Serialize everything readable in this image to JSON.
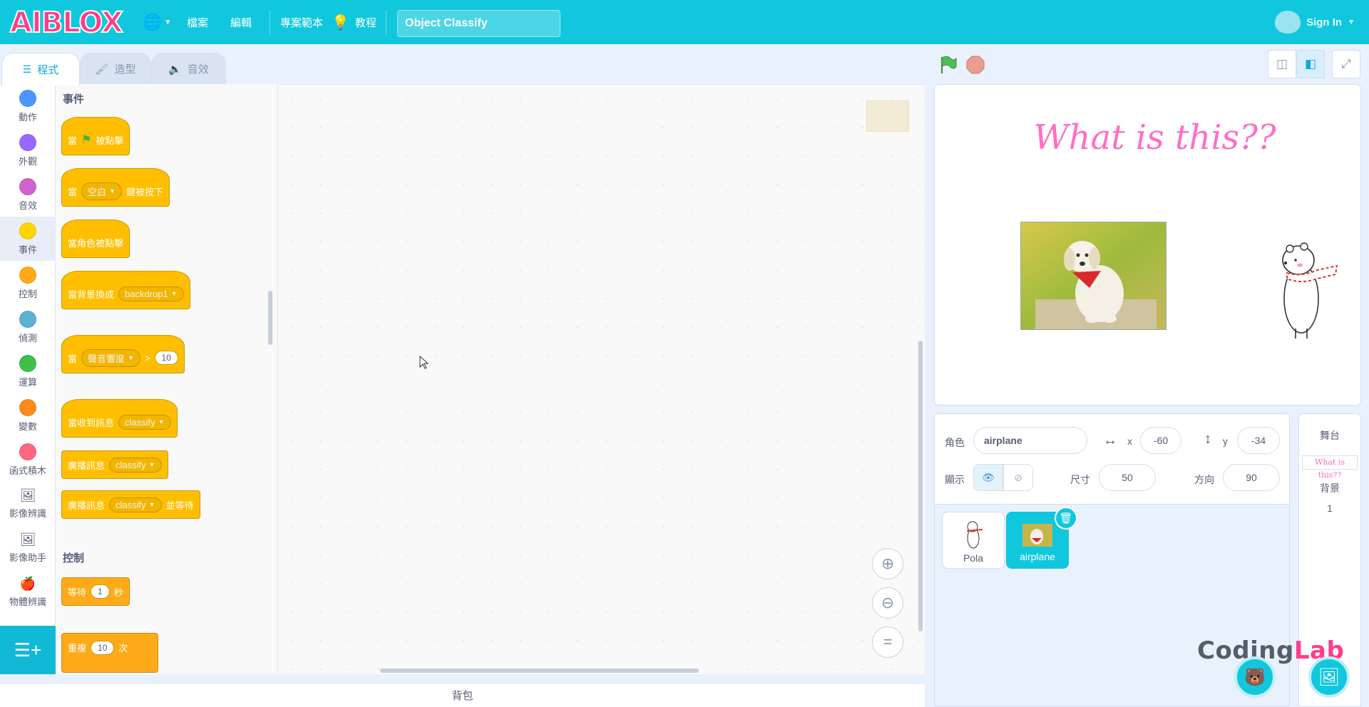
{
  "app": {
    "logo": "AIBLOX",
    "menu": {
      "file": "檔案",
      "edit": "編輯",
      "examples": "專案範本",
      "tutorials": "教程"
    },
    "project_title": "Object Classify",
    "signin": "Sign In"
  },
  "tabs": {
    "code": "程式",
    "costumes": "造型",
    "sounds": "音效"
  },
  "categories": [
    {
      "label": "動作",
      "color": "#4c97ff"
    },
    {
      "label": "外觀",
      "color": "#9966ff"
    },
    {
      "label": "音效",
      "color": "#cf63cf"
    },
    {
      "label": "事件",
      "color": "#ffd500"
    },
    {
      "label": "控制",
      "color": "#ffab19"
    },
    {
      "label": "偵測",
      "color": "#5cb1d6"
    },
    {
      "label": "運算",
      "color": "#40bf4a"
    },
    {
      "label": "變數",
      "color": "#ff8c1a"
    },
    {
      "label": "函式積木",
      "color": "#ff6680"
    },
    {
      "label": "影像辨識"
    },
    {
      "label": "影像助手"
    },
    {
      "label": "物體辨識"
    }
  ],
  "palette": {
    "events_title": "事件",
    "when": "當",
    "clicked": "被點擊",
    "space": "空白",
    "key_pressed": "鍵被按下",
    "sprite_clicked": "當角色被點擊",
    "backdrop_switch": "當背景換成",
    "backdrop1": "backdrop1",
    "loudness": "聲音響度",
    "gt": ">",
    "loud_val": "10",
    "receive": "當收到訊息",
    "classify": "classify",
    "broadcast": "廣播訊息",
    "and_wait": "並等待",
    "control_title": "控制",
    "wait": "等待",
    "wait_val": "1",
    "seconds": "秒",
    "repeat": "重複",
    "repeat_val": "10",
    "times": "次"
  },
  "backpack": "背包",
  "stage": {
    "title": "What is this??"
  },
  "sprite": {
    "label_sprite": "角色",
    "name": "airplane",
    "x_label": "x",
    "x": "-60",
    "y_label": "y",
    "y": "-34",
    "show_label": "顯示",
    "size_label": "尺寸",
    "size": "50",
    "direction_label": "方向",
    "direction": "90"
  },
  "sprites": [
    {
      "name": "Pola"
    },
    {
      "name": "airplane"
    }
  ],
  "stage_panel": {
    "title": "舞台",
    "thumb_text": "What is this??",
    "backdrops_label": "背景",
    "backdrops_count": "1"
  },
  "watermark": {
    "part1": "Coding",
    "part2": "Lab",
    "color2": "#ff3d8c"
  }
}
